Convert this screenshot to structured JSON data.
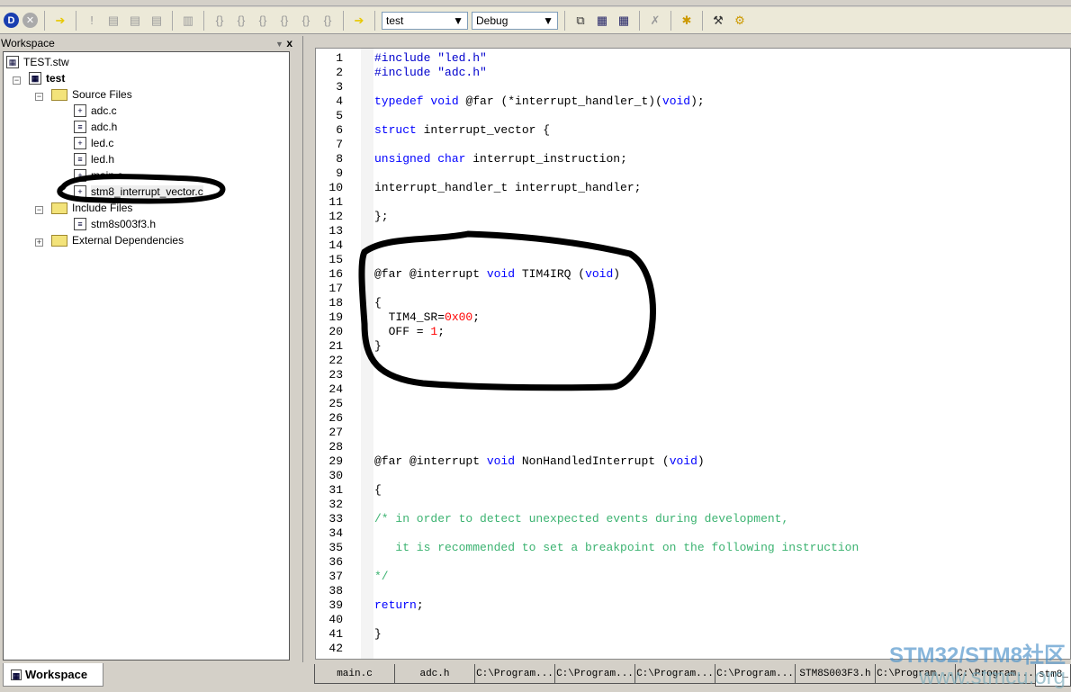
{
  "toolbar": {
    "config_combo": "test",
    "build_combo": "Debug",
    "icons": [
      "debug-icon",
      "stop-icon",
      "arrow-icon",
      "exclamation-icon",
      "step-icon",
      "step-icon",
      "step-icon",
      "register-icon",
      "step-into-icon",
      "step-over-icon",
      "step-out-icon",
      "run-to-icon",
      "brace-icon",
      "brace-icon",
      "arrow-icon",
      "compile-icon",
      "build-icon",
      "rebuild-icon",
      "clean-icon",
      "tools-icon",
      "help-icon",
      "settings-icon"
    ]
  },
  "workspace": {
    "title": "Workspace",
    "tab_label": "Workspace",
    "tree": {
      "root": "TEST.stw",
      "project": "test",
      "source_folder": "Source Files",
      "source_files": [
        "adc.c",
        "adc.h",
        "led.c",
        "led.h",
        "main.c",
        "stm8_interrupt_vector.c"
      ],
      "include_folder": "Include Files",
      "include_files": [
        "stm8s003f3.h"
      ],
      "external": "External Dependencies"
    }
  },
  "editor": {
    "lines": [
      [
        [
          "#include \"led.h\"",
          "d"
        ]
      ],
      [
        [
          "#include \"adc.h\"",
          "d"
        ]
      ],
      [],
      [
        [
          "typedef",
          "k"
        ],
        [
          " ",
          "p"
        ],
        [
          "void",
          "k"
        ],
        [
          " @far (*interrupt_handler_t)(",
          "p"
        ],
        [
          "void",
          "k"
        ],
        [
          ");",
          "p"
        ]
      ],
      [],
      [
        [
          "struct",
          "k"
        ],
        [
          " interrupt_vector {",
          "p"
        ]
      ],
      [],
      [
        [
          "unsigned",
          "k"
        ],
        [
          " ",
          "p"
        ],
        [
          "char",
          "k"
        ],
        [
          " interrupt_instruction;",
          "p"
        ]
      ],
      [],
      [
        [
          "interrupt_handler_t interrupt_handler;",
          "p"
        ]
      ],
      [],
      [
        [
          "};",
          "p"
        ]
      ],
      [],
      [],
      [],
      [
        [
          "@far @interrupt ",
          "p"
        ],
        [
          "void",
          "k"
        ],
        [
          " TIM4IRQ (",
          "p"
        ],
        [
          "void",
          "k"
        ],
        [
          ")",
          "p"
        ]
      ],
      [],
      [
        [
          "{",
          "p"
        ]
      ],
      [
        [
          "  TIM4_SR=",
          "p"
        ],
        [
          "0x00",
          "n"
        ],
        [
          ";",
          "p"
        ]
      ],
      [
        [
          "  OFF = ",
          "p"
        ],
        [
          "1",
          "n"
        ],
        [
          ";",
          "p"
        ]
      ],
      [
        [
          "}",
          "p"
        ]
      ],
      [],
      [],
      [],
      [],
      [],
      [],
      [],
      [
        [
          "@far @interrupt ",
          "p"
        ],
        [
          "void",
          "k"
        ],
        [
          " NonHandledInterrupt (",
          "p"
        ],
        [
          "void",
          "k"
        ],
        [
          ")",
          "p"
        ]
      ],
      [],
      [
        [
          "{",
          "p"
        ]
      ],
      [],
      [
        [
          "/* in order to detect unexpected events during development,",
          "c"
        ]
      ],
      [],
      [
        [
          "   it is recommended to set a breakpoint on the following instruction",
          "c"
        ]
      ],
      [],
      [
        [
          "*/",
          "c"
        ]
      ],
      [],
      [
        [
          "return",
          "k"
        ],
        [
          ";",
          "p"
        ]
      ],
      [],
      [
        [
          "}",
          "p"
        ]
      ],
      []
    ]
  },
  "tabs": [
    "main.c",
    "adc.h",
    "C:\\Program...",
    "C:\\Program...",
    "C:\\Program...",
    "C:\\Program...",
    "STM8S003F3.h",
    "C:\\Program...",
    "C:\\Program...",
    "stm8_"
  ],
  "watermark": {
    "line1": "STM32/STM8社区",
    "line2": "www.stmcu.org"
  }
}
